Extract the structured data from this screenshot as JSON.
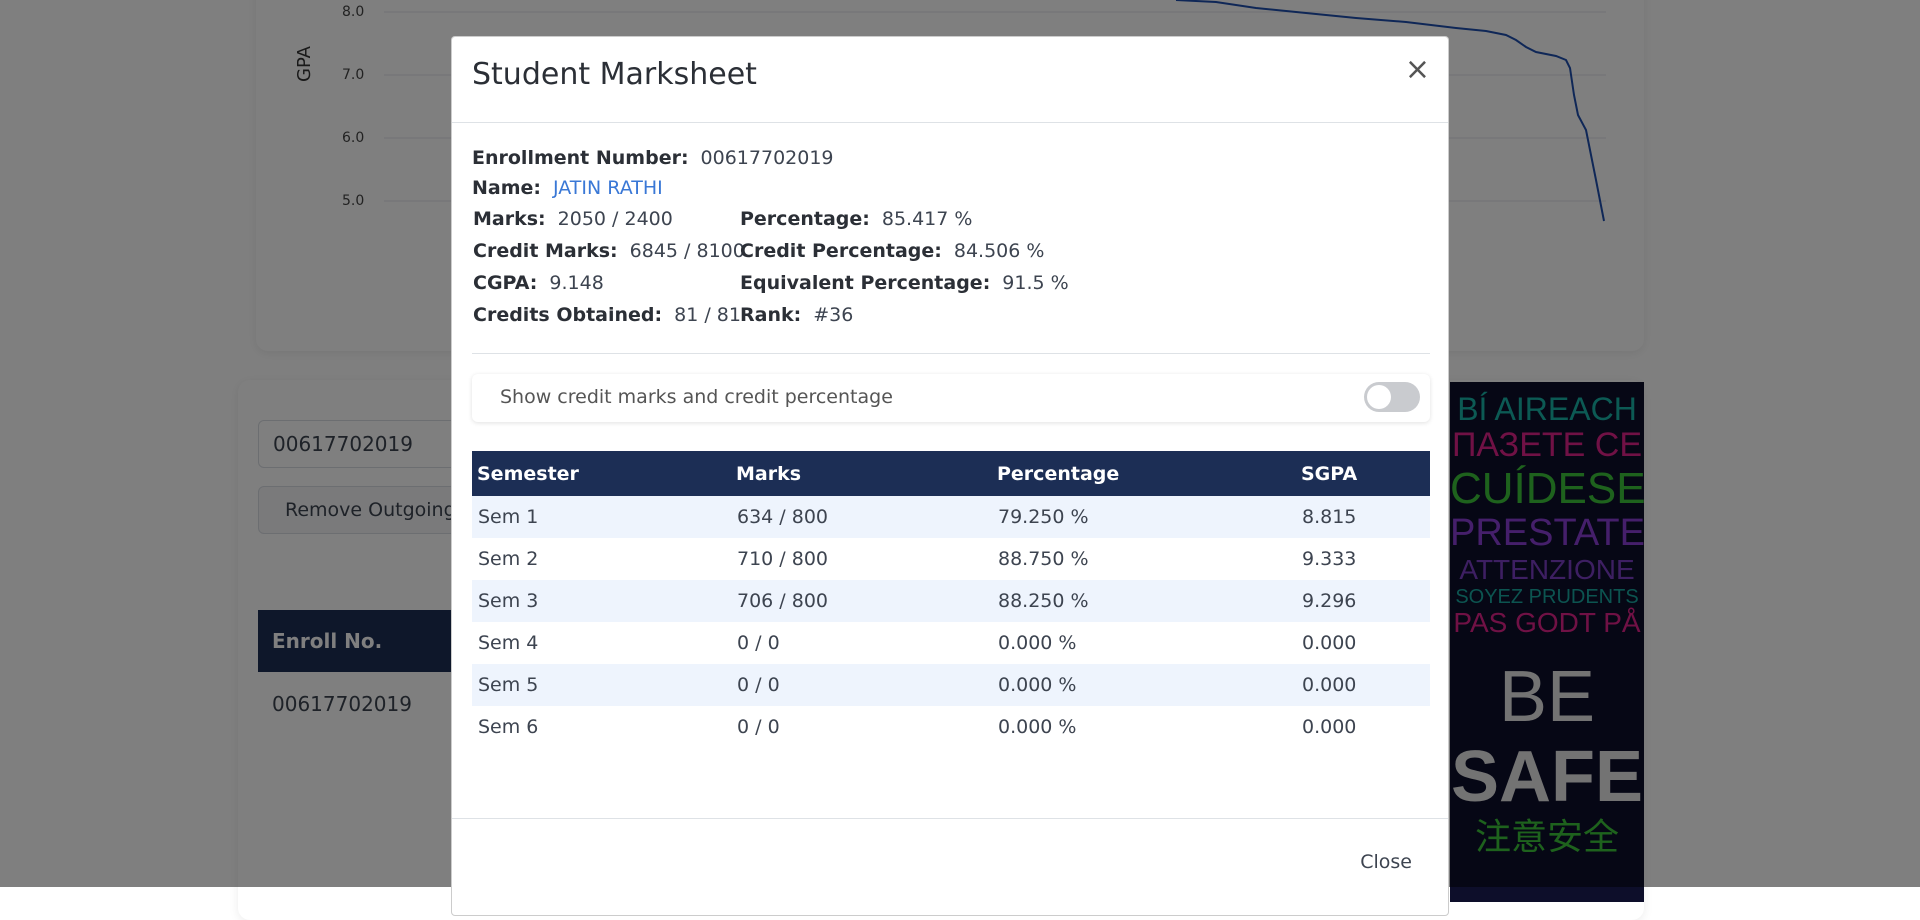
{
  "background": {
    "chart": {
      "ylabel": "GPA",
      "ticks": [
        "8.0",
        "7.0",
        "6.0",
        "5.0"
      ]
    },
    "search_value": "00617702019",
    "remove_button": "Remove Outgoing",
    "table_header": "Enroll No.",
    "table_value": "00617702019",
    "ad_lines": [
      "BÍ AIREACH",
      "ПАЗЕТЕ СЕ",
      "CUÍDESE",
      "PRESTATE",
      "ATTENZIONE",
      "SOYEZ PRUDENTS",
      "PAS GODT PÅ",
      "BE",
      "SAFE",
      "注意安全"
    ]
  },
  "modal": {
    "title": "Student Marksheet",
    "close_icon": "×",
    "enrollment_label": "Enrollment Number:",
    "enrollment_value": "00617702019",
    "name_label": "Name:",
    "name_value": "JATIN RATHI",
    "marks_label": "Marks:",
    "marks_value": "2050 / 2400",
    "percentage_label": "Percentage:",
    "percentage_value": "85.417 %",
    "credit_marks_label": "Credit Marks:",
    "credit_marks_value": "6845 / 8100",
    "credit_percentage_label": "Credit Percentage:",
    "credit_percentage_value": "84.506 %",
    "cgpa_label": "CGPA:",
    "cgpa_value": "9.148",
    "equivalent_percentage_label": "Equivalent Percentage:",
    "equivalent_percentage_value": "91.5 %",
    "credits_label": "Credits Obtained:",
    "credits_value": "81 / 81",
    "rank_label": "Rank:",
    "rank_value": "#36",
    "toggle_label": "Show credit marks and credit percentage",
    "toggle_on": false,
    "table": {
      "headers": [
        "Semester",
        "Marks",
        "Percentage",
        "SGPA"
      ],
      "rows": [
        [
          "Sem 1",
          "634 / 800",
          "79.250 %",
          "8.815"
        ],
        [
          "Sem 2",
          "710 / 800",
          "88.750 %",
          "9.333"
        ],
        [
          "Sem 3",
          "706 / 800",
          "88.250 %",
          "9.296"
        ],
        [
          "Sem 4",
          "0 / 0",
          "0.000 %",
          "0.000"
        ],
        [
          "Sem 5",
          "0 / 0",
          "0.000 %",
          "0.000"
        ],
        [
          "Sem 6",
          "0 / 0",
          "0.000 %",
          "0.000"
        ]
      ]
    },
    "footer_close": "Close"
  },
  "colors": {
    "header_navy": "#1c2e55",
    "link_blue": "#3a78d6",
    "row_stripe": "#eef4fd"
  }
}
